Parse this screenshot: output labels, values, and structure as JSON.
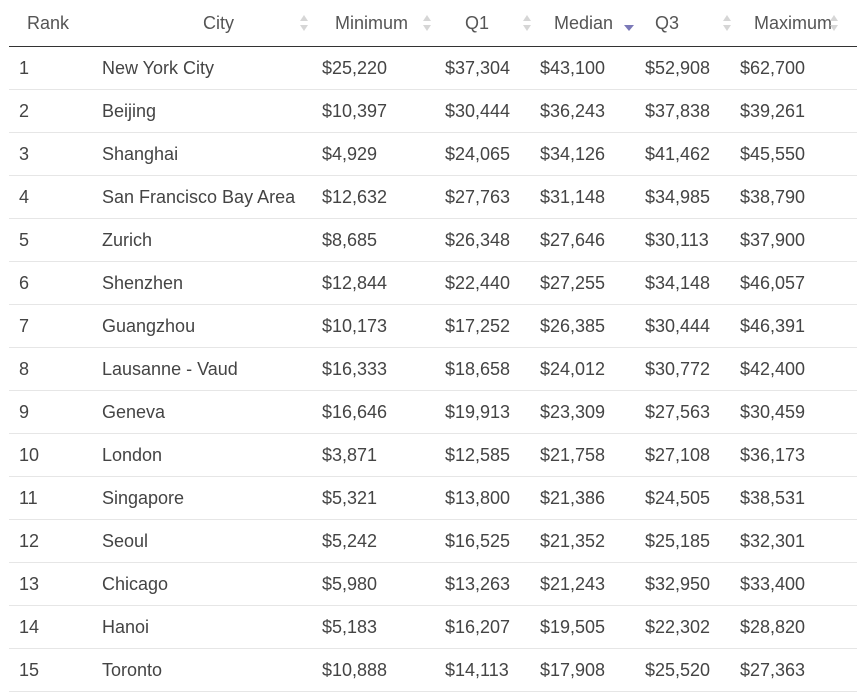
{
  "table": {
    "columns": [
      {
        "key": "rank",
        "label": "Rank",
        "sortable": false
      },
      {
        "key": "city",
        "label": "City",
        "sortable": true
      },
      {
        "key": "min",
        "label": "Minimum",
        "sortable": true
      },
      {
        "key": "q1",
        "label": "Q1",
        "sortable": true
      },
      {
        "key": "median",
        "label": "Median",
        "sortable": true,
        "sorted": "desc"
      },
      {
        "key": "q3",
        "label": "Q3",
        "sortable": true
      },
      {
        "key": "max",
        "label": "Maximum",
        "sortable": true
      }
    ],
    "rows": [
      [
        "1",
        "New York City",
        "$25,220",
        "$37,304",
        "$43,100",
        "$52,908",
        "$62,700"
      ],
      [
        "2",
        "Beijing",
        "$10,397",
        "$30,444",
        "$36,243",
        "$37,838",
        "$39,261"
      ],
      [
        "3",
        "Shanghai",
        "$4,929",
        "$24,065",
        "$34,126",
        "$41,462",
        "$45,550"
      ],
      [
        "4",
        "San Francisco Bay Area",
        "$12,632",
        "$27,763",
        "$31,148",
        "$34,985",
        "$38,790"
      ],
      [
        "5",
        "Zurich",
        "$8,685",
        "$26,348",
        "$27,646",
        "$30,113",
        "$37,900"
      ],
      [
        "6",
        "Shenzhen",
        "$12,844",
        "$22,440",
        "$27,255",
        "$34,148",
        "$46,057"
      ],
      [
        "7",
        "Guangzhou",
        "$10,173",
        "$17,252",
        "$26,385",
        "$30,444",
        "$46,391"
      ],
      [
        "8",
        "Lausanne - Vaud",
        "$16,333",
        "$18,658",
        "$24,012",
        "$30,772",
        "$42,400"
      ],
      [
        "9",
        "Geneva",
        "$16,646",
        "$19,913",
        "$23,309",
        "$27,563",
        "$30,459"
      ],
      [
        "10",
        "London",
        "$3,871",
        "$12,585",
        "$21,758",
        "$27,108",
        "$36,173"
      ],
      [
        "11",
        "Singapore",
        "$5,321",
        "$13,800",
        "$21,386",
        "$24,505",
        "$38,531"
      ],
      [
        "12",
        "Seoul",
        "$5,242",
        "$16,525",
        "$21,352",
        "$25,185",
        "$32,301"
      ],
      [
        "13",
        "Chicago",
        "$5,980",
        "$13,263",
        "$21,243",
        "$32,950",
        "$33,400"
      ],
      [
        "14",
        "Hanoi",
        "$5,183",
        "$16,207",
        "$19,505",
        "$22,302",
        "$28,820"
      ],
      [
        "15",
        "Toronto",
        "$10,888",
        "$14,113",
        "$17,908",
        "$25,520",
        "$27,363"
      ]
    ]
  },
  "colors": {
    "sort_active": "#7b79b8",
    "sort_inactive": "#d6d6d6",
    "header_rule": "#333333",
    "row_rule": "#e6e6e6"
  },
  "icons": {
    "sort_inactive": "sort-both-icon",
    "sort_active": "sort-descending-icon"
  }
}
